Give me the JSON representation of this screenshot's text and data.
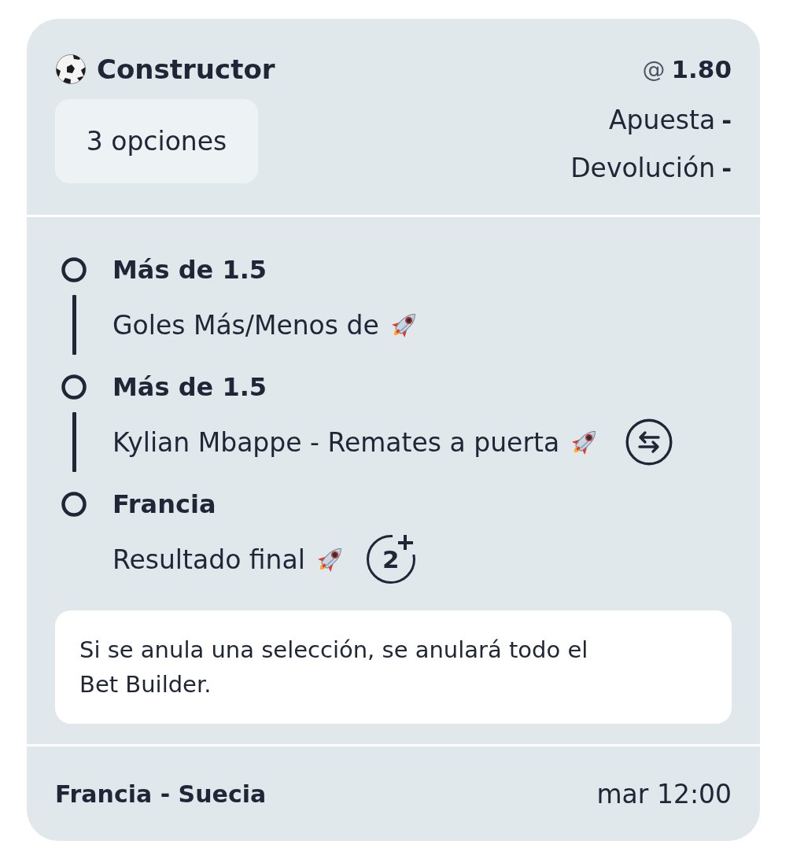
{
  "header": {
    "title": "Constructor",
    "selections": "3 opciones",
    "odds_prefix": "@",
    "odds": "1.80",
    "stake_label": "Apuesta",
    "stake_value": "-",
    "return_label": "Devolución",
    "return_value": "-"
  },
  "legs": [
    {
      "selection": "Más de 1.5",
      "market": "Goles Más/Menos de",
      "boosted": true
    },
    {
      "selection": "Más de 1.5",
      "market": "Kylian Mbappe - Remates a puerta",
      "boosted": true,
      "extras": [
        {
          "kind": "swap"
        }
      ]
    },
    {
      "selection": "Francia",
      "market": "Resultado final",
      "boosted": true,
      "extras": [
        {
          "kind": "early_payout",
          "label": "2"
        }
      ]
    }
  ],
  "notice": "Si se anula una selección, se anulará todo el Bet Builder.",
  "footer": {
    "event": "Francia - Suecia",
    "time": "mar 12:00"
  }
}
